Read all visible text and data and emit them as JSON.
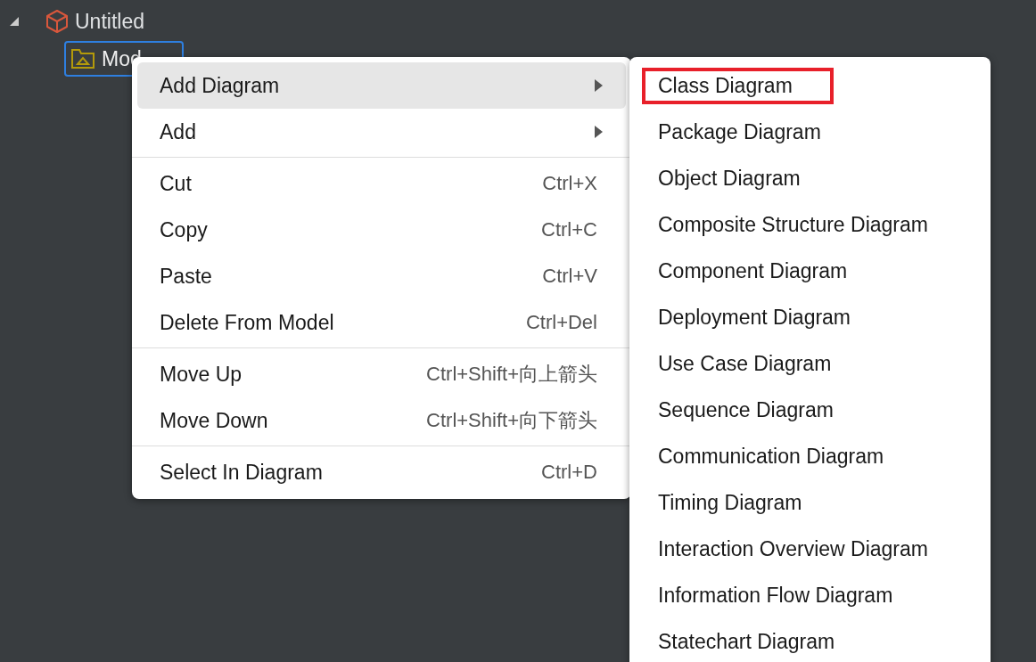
{
  "tree": {
    "root": {
      "label": "Untitled",
      "expanded": true,
      "children": [
        {
          "label": "Mod",
          "selected": true
        }
      ]
    }
  },
  "context_menu": {
    "groups": [
      [
        {
          "kind": "submenu",
          "label": "Add Diagram",
          "selected": true
        },
        {
          "kind": "submenu",
          "label": "Add",
          "selected": false
        }
      ],
      [
        {
          "kind": "command",
          "label": "Cut",
          "shortcut": "Ctrl+X",
          "selected": false
        },
        {
          "kind": "command",
          "label": "Copy",
          "shortcut": "Ctrl+C",
          "selected": false
        },
        {
          "kind": "command",
          "label": "Paste",
          "shortcut": "Ctrl+V",
          "selected": false
        },
        {
          "kind": "command",
          "label": "Delete From Model",
          "shortcut": "Ctrl+Del",
          "selected": false
        }
      ],
      [
        {
          "kind": "command",
          "label": "Move Up",
          "shortcut": "Ctrl+Shift+向上箭头",
          "selected": false
        },
        {
          "kind": "command",
          "label": "Move Down",
          "shortcut": "Ctrl+Shift+向下箭头",
          "selected": false
        }
      ],
      [
        {
          "kind": "command",
          "label": "Select In Diagram",
          "shortcut": "Ctrl+D",
          "selected": false
        }
      ]
    ]
  },
  "submenu": {
    "items": [
      {
        "label": "Class Diagram",
        "highlighted": true
      },
      {
        "label": "Package Diagram",
        "highlighted": false
      },
      {
        "label": "Object Diagram",
        "highlighted": false
      },
      {
        "label": "Composite Structure Diagram",
        "highlighted": false
      },
      {
        "label": "Component Diagram",
        "highlighted": false
      },
      {
        "label": "Deployment Diagram",
        "highlighted": false
      },
      {
        "label": "Use Case Diagram",
        "highlighted": false
      },
      {
        "label": "Sequence Diagram",
        "highlighted": false
      },
      {
        "label": "Communication Diagram",
        "highlighted": false
      },
      {
        "label": "Timing Diagram",
        "highlighted": false
      },
      {
        "label": "Interaction Overview Diagram",
        "highlighted": false
      },
      {
        "label": "Information Flow Diagram",
        "highlighted": false
      },
      {
        "label": "Statechart Diagram",
        "highlighted": false
      }
    ]
  }
}
